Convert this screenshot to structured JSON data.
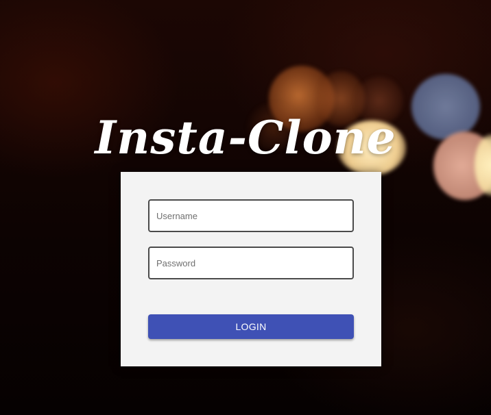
{
  "app": {
    "title": "Insta-Clone"
  },
  "login_form": {
    "username": {
      "placeholder": "Username",
      "value": ""
    },
    "password": {
      "placeholder": "Password",
      "value": ""
    },
    "submit_label": "LOGIN"
  },
  "colors": {
    "primary_button": "#3f51b5",
    "card_background": "#f3f3f3",
    "title_text": "#ffffff"
  }
}
